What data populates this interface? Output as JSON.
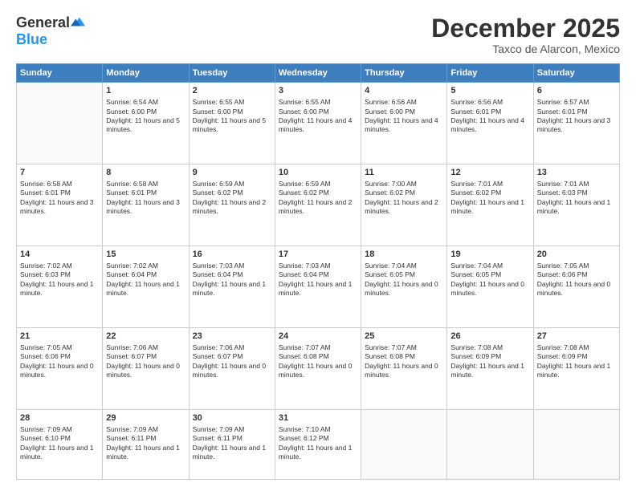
{
  "header": {
    "logo_general": "General",
    "logo_blue": "Blue",
    "month": "December 2025",
    "location": "Taxco de Alarcon, Mexico"
  },
  "weekdays": [
    "Sunday",
    "Monday",
    "Tuesday",
    "Wednesday",
    "Thursday",
    "Friday",
    "Saturday"
  ],
  "weeks": [
    [
      {
        "day": null
      },
      {
        "day": 1,
        "sunrise": "6:54 AM",
        "sunset": "6:00 PM",
        "daylight": "11 hours and 5 minutes."
      },
      {
        "day": 2,
        "sunrise": "6:55 AM",
        "sunset": "6:00 PM",
        "daylight": "11 hours and 5 minutes."
      },
      {
        "day": 3,
        "sunrise": "6:55 AM",
        "sunset": "6:00 PM",
        "daylight": "11 hours and 4 minutes."
      },
      {
        "day": 4,
        "sunrise": "6:56 AM",
        "sunset": "6:00 PM",
        "daylight": "11 hours and 4 minutes."
      },
      {
        "day": 5,
        "sunrise": "6:56 AM",
        "sunset": "6:01 PM",
        "daylight": "11 hours and 4 minutes."
      },
      {
        "day": 6,
        "sunrise": "6:57 AM",
        "sunset": "6:01 PM",
        "daylight": "11 hours and 3 minutes."
      }
    ],
    [
      {
        "day": 7,
        "sunrise": "6:58 AM",
        "sunset": "6:01 PM",
        "daylight": "11 hours and 3 minutes."
      },
      {
        "day": 8,
        "sunrise": "6:58 AM",
        "sunset": "6:01 PM",
        "daylight": "11 hours and 3 minutes."
      },
      {
        "day": 9,
        "sunrise": "6:59 AM",
        "sunset": "6:02 PM",
        "daylight": "11 hours and 2 minutes."
      },
      {
        "day": 10,
        "sunrise": "6:59 AM",
        "sunset": "6:02 PM",
        "daylight": "11 hours and 2 minutes."
      },
      {
        "day": 11,
        "sunrise": "7:00 AM",
        "sunset": "6:02 PM",
        "daylight": "11 hours and 2 minutes."
      },
      {
        "day": 12,
        "sunrise": "7:01 AM",
        "sunset": "6:02 PM",
        "daylight": "11 hours and 1 minute."
      },
      {
        "day": 13,
        "sunrise": "7:01 AM",
        "sunset": "6:03 PM",
        "daylight": "11 hours and 1 minute."
      }
    ],
    [
      {
        "day": 14,
        "sunrise": "7:02 AM",
        "sunset": "6:03 PM",
        "daylight": "11 hours and 1 minute."
      },
      {
        "day": 15,
        "sunrise": "7:02 AM",
        "sunset": "6:04 PM",
        "daylight": "11 hours and 1 minute."
      },
      {
        "day": 16,
        "sunrise": "7:03 AM",
        "sunset": "6:04 PM",
        "daylight": "11 hours and 1 minute."
      },
      {
        "day": 17,
        "sunrise": "7:03 AM",
        "sunset": "6:04 PM",
        "daylight": "11 hours and 1 minute."
      },
      {
        "day": 18,
        "sunrise": "7:04 AM",
        "sunset": "6:05 PM",
        "daylight": "11 hours and 0 minutes."
      },
      {
        "day": 19,
        "sunrise": "7:04 AM",
        "sunset": "6:05 PM",
        "daylight": "11 hours and 0 minutes."
      },
      {
        "day": 20,
        "sunrise": "7:05 AM",
        "sunset": "6:06 PM",
        "daylight": "11 hours and 0 minutes."
      }
    ],
    [
      {
        "day": 21,
        "sunrise": "7:05 AM",
        "sunset": "6:06 PM",
        "daylight": "11 hours and 0 minutes."
      },
      {
        "day": 22,
        "sunrise": "7:06 AM",
        "sunset": "6:07 PM",
        "daylight": "11 hours and 0 minutes."
      },
      {
        "day": 23,
        "sunrise": "7:06 AM",
        "sunset": "6:07 PM",
        "daylight": "11 hours and 0 minutes."
      },
      {
        "day": 24,
        "sunrise": "7:07 AM",
        "sunset": "6:08 PM",
        "daylight": "11 hours and 0 minutes."
      },
      {
        "day": 25,
        "sunrise": "7:07 AM",
        "sunset": "6:08 PM",
        "daylight": "11 hours and 0 minutes."
      },
      {
        "day": 26,
        "sunrise": "7:08 AM",
        "sunset": "6:09 PM",
        "daylight": "11 hours and 1 minute."
      },
      {
        "day": 27,
        "sunrise": "7:08 AM",
        "sunset": "6:09 PM",
        "daylight": "11 hours and 1 minute."
      }
    ],
    [
      {
        "day": 28,
        "sunrise": "7:09 AM",
        "sunset": "6:10 PM",
        "daylight": "11 hours and 1 minute."
      },
      {
        "day": 29,
        "sunrise": "7:09 AM",
        "sunset": "6:11 PM",
        "daylight": "11 hours and 1 minute."
      },
      {
        "day": 30,
        "sunrise": "7:09 AM",
        "sunset": "6:11 PM",
        "daylight": "11 hours and 1 minute."
      },
      {
        "day": 31,
        "sunrise": "7:10 AM",
        "sunset": "6:12 PM",
        "daylight": "11 hours and 1 minute."
      },
      {
        "day": null
      },
      {
        "day": null
      },
      {
        "day": null
      }
    ]
  ],
  "labels": {
    "sunrise_prefix": "Sunrise: ",
    "sunset_prefix": "Sunset: ",
    "daylight_prefix": "Daylight: "
  }
}
